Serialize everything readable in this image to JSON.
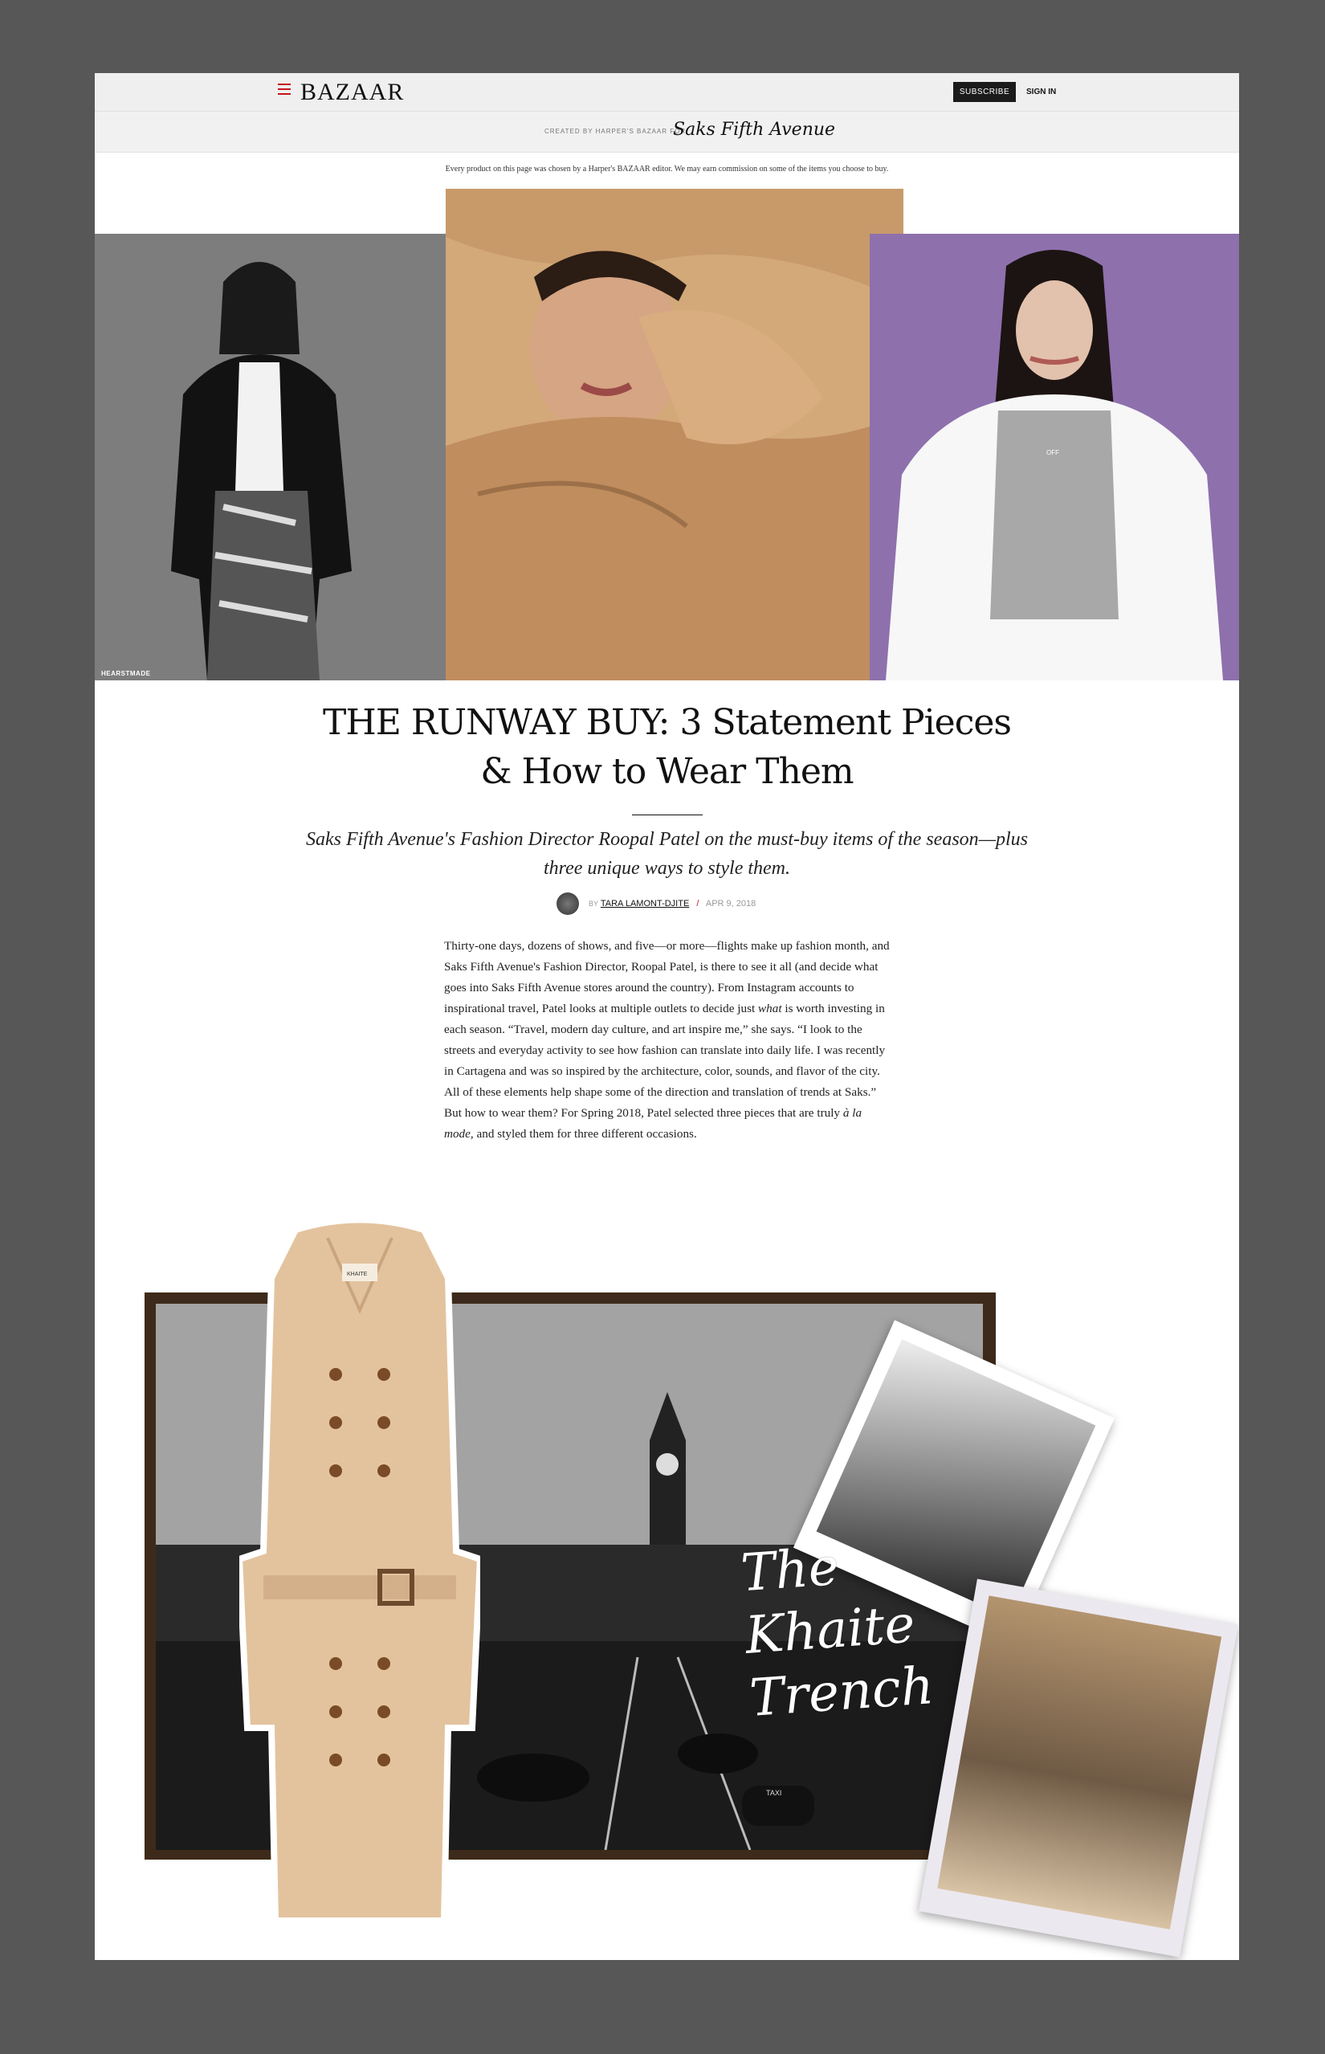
{
  "header": {
    "menu_icon": "hamburger-icon",
    "logo": "BAZAAR",
    "subscribe_label": "SUBSCRIBE",
    "signin_label": "SIGN IN"
  },
  "sponsor": {
    "created_text": "CREATED BY HARPER'S BAZAAR FOR",
    "sponsor_logo": "Saks Fifth Avenue"
  },
  "disclaimer": "Every product on this page was chosen by a Harper's BAZAAR editor. We may earn commission on some of the items you choose to buy.",
  "hero": {
    "photo_credit": "HEARSTMADE",
    "shirt_text": "OFF"
  },
  "article": {
    "headline": "THE RUNWAY BUY: 3 Statement Pieces & How to Wear Them",
    "dek": "Saks Fifth Avenue's Fashion Director Roopal Patel on the must-buy items of the season—plus three unique ways to style them.",
    "byline": {
      "by": "BY",
      "author": "TARA LAMONT-DJITE",
      "separator": "/",
      "date": "APR 9, 2018"
    },
    "body": [
      "Thirty-one days, dozens of shows, and five—or more—flights make up fashion month, and Saks Fifth Avenue's Fashion Director, Roopal Patel, is there to see it all (and decide what goes into Saks Fifth Avenue stores around the country). From Instagram accounts to inspirational travel, Patel looks at multiple outlets to decide just ",
      "what",
      " is worth investing in each season. “Travel, modern day culture, and art inspire me,” she says. “I look to the streets and everyday activity to see how fashion can translate into daily life. I was recently in Cartagena and was so inspired by the architecture, color, sounds, and flavor of the city. All of these elements help shape some of the direction and translation of trends at Saks.” But how to wear them? For Spring 2018, Patel selected three pieces that are truly ",
      "à la mode,",
      " and styled them for three different occasions."
    ]
  },
  "collage": {
    "coat_label": "KHAITE",
    "script_lines": [
      "The",
      "Khaite",
      "Trench"
    ],
    "taxi_sign": "TAXI"
  },
  "colors": {
    "page_bg": "#575757",
    "accent_red": "#c4151c",
    "topbar_bg": "#efefef",
    "subscribe_bg": "#1b1b1b",
    "purple_bg": "#8e70ad"
  }
}
